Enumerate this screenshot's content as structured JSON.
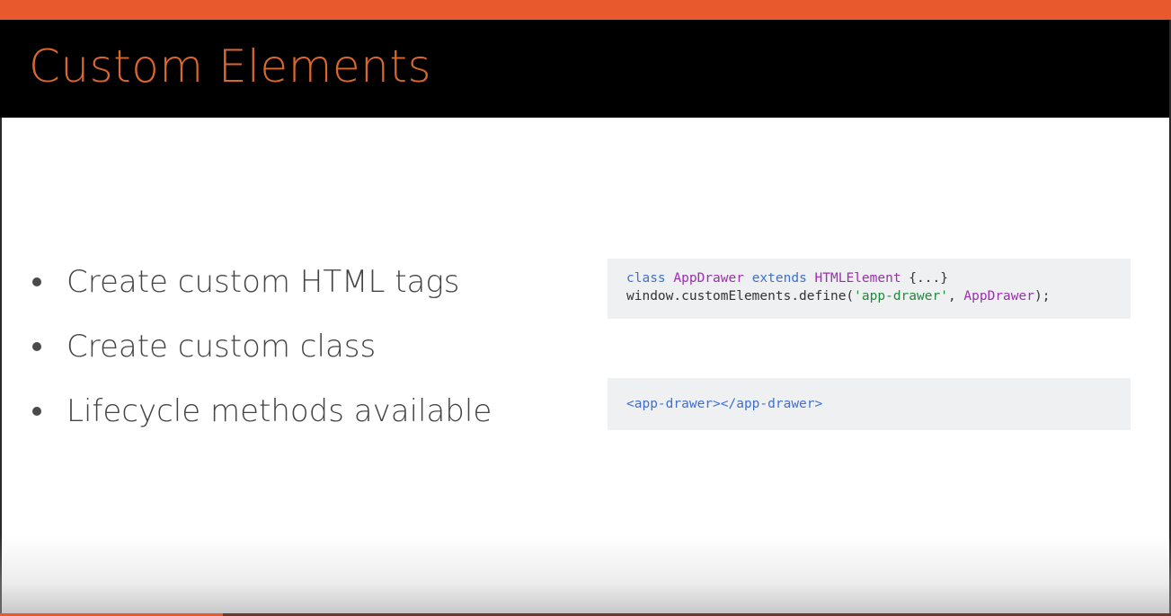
{
  "slide": {
    "title": "Custom Elements",
    "bullets": [
      "Create custom HTML tags",
      "Create custom class",
      "Lifecycle methods available"
    ],
    "code_block_1": {
      "line_1": {
        "keyword_class": "class",
        "class_name": "AppDrawer",
        "keyword_extends": "extends",
        "base_class": "HTMLElement",
        "body": " {...}"
      },
      "line_2": {
        "prefix": "window.customElements.define(",
        "string_arg": "'app-drawer'",
        "separator": ", ",
        "class_arg": "AppDrawer",
        "suffix": ");"
      }
    },
    "code_block_2": {
      "markup": "<app-drawer></app-drawer>"
    }
  },
  "colors": {
    "accent": "#e85a2e",
    "title_text": "#d9682f",
    "title_bar": "#000000",
    "code_keyword": "#3f6fd1",
    "code_class": "#9b2fae",
    "code_string": "#1f8a3a",
    "code_background": "#eef0f2"
  },
  "video": {
    "progress": 0.19
  }
}
